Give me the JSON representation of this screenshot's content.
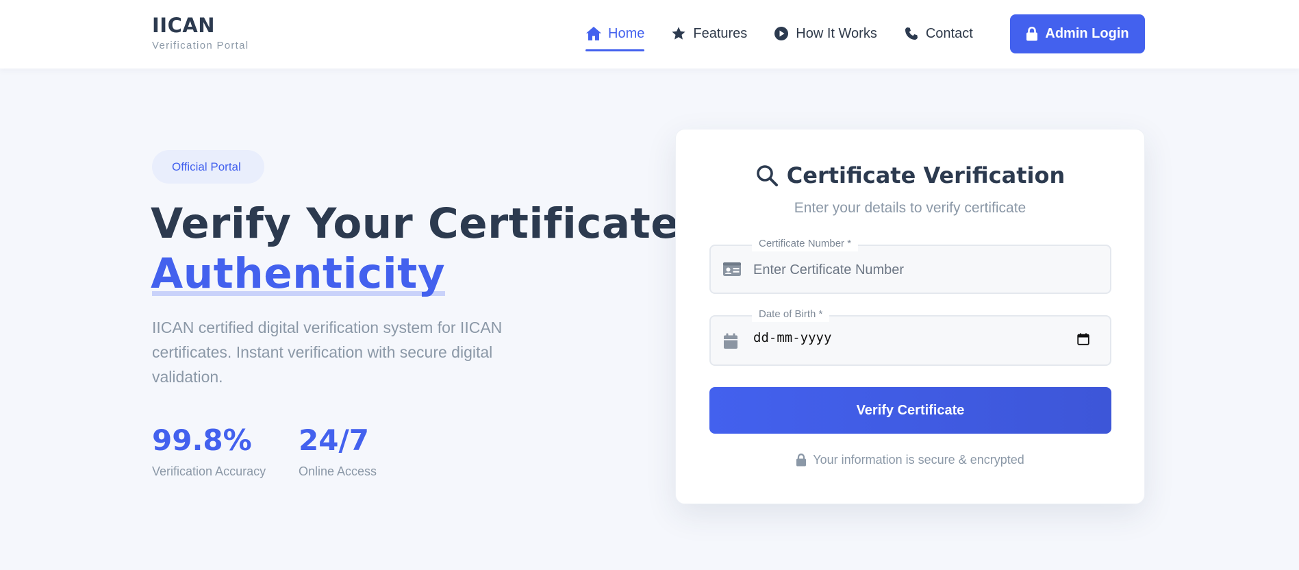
{
  "brand": {
    "title": "IICAN",
    "subtitle": "Verification Portal"
  },
  "nav": {
    "items": [
      {
        "label": "Home",
        "icon": "home-icon",
        "active": true
      },
      {
        "label": "Features",
        "icon": "star-icon"
      },
      {
        "label": "How It Works",
        "icon": "play-circle-icon"
      },
      {
        "label": "Contact",
        "icon": "phone-icon"
      }
    ],
    "admin_label": "Admin Login"
  },
  "hero": {
    "badge": "Official Portal",
    "title_line1": "Verify Your Certificate",
    "title_accent": "Authenticity",
    "description": "IICAN certified digital verification system for IICAN certificates. Instant verification with secure digital validation.",
    "stats": [
      {
        "value": "99.8%",
        "label": "Verification Accuracy"
      },
      {
        "value": "24/7",
        "label": "Online Access"
      }
    ]
  },
  "card": {
    "title": "Certificate Verification",
    "subtitle": "Enter your details to verify certificate",
    "certificate_field": {
      "label": "Certificate Number *",
      "placeholder": "Enter Certificate Number",
      "value": ""
    },
    "dob_field": {
      "label": "Date of Birth *",
      "value": "dd-mm-yyyy"
    },
    "verify_label": "Verify Certificate",
    "secure_note": "Your information is secure & encrypted"
  },
  "colors": {
    "accent": "#4361ee",
    "heading": "#2c3a4f",
    "muted": "#8b98a7",
    "background": "#f5f7fc"
  }
}
